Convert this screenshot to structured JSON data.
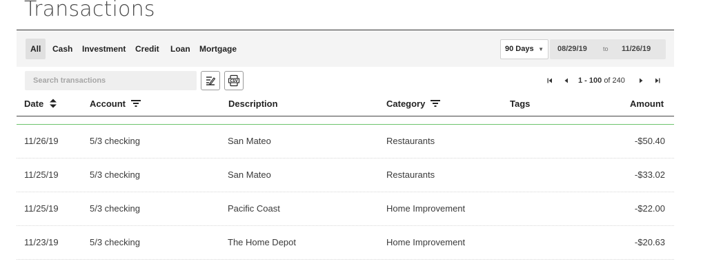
{
  "page_title": "Transactions",
  "filters": [
    "All",
    "Cash",
    "Investment",
    "Credit",
    "Loan",
    "Mortgage"
  ],
  "date_range": {
    "preset": "90 Days",
    "from": "08/29/19",
    "to_label": "to",
    "to": "11/26/19"
  },
  "search": {
    "placeholder": "Search transactions",
    "value": ""
  },
  "pagination": {
    "range": "1 - 100",
    "of_label": "of 240"
  },
  "columns": {
    "date": "Date",
    "account": "Account",
    "description": "Description",
    "category": "Category",
    "tags": "Tags",
    "amount": "Amount"
  },
  "rows": [
    {
      "date": "11/26/19",
      "account": "5/3 checking",
      "description": "San Mateo",
      "category": "Restaurants",
      "tags": "",
      "amount": "-$50.40"
    },
    {
      "date": "11/25/19",
      "account": "5/3 checking",
      "description": "San Mateo",
      "category": "Restaurants",
      "tags": "",
      "amount": "-$33.02"
    },
    {
      "date": "11/25/19",
      "account": "5/3 checking",
      "description": "Pacific Coast",
      "category": "Home Improvement",
      "tags": "",
      "amount": "-$22.00"
    },
    {
      "date": "11/23/19",
      "account": "5/3 checking",
      "description": "The Home Depot",
      "category": "Home Improvement",
      "tags": "",
      "amount": "-$20.63"
    }
  ],
  "colors": {
    "accent_green": "#6cc36c",
    "toolbar_bg": "#f4f4f4"
  },
  "icons": {
    "edit": "edit-list-icon",
    "export": "csv-export-icon",
    "sort": "sort-icon",
    "filter": "filter-icon"
  }
}
